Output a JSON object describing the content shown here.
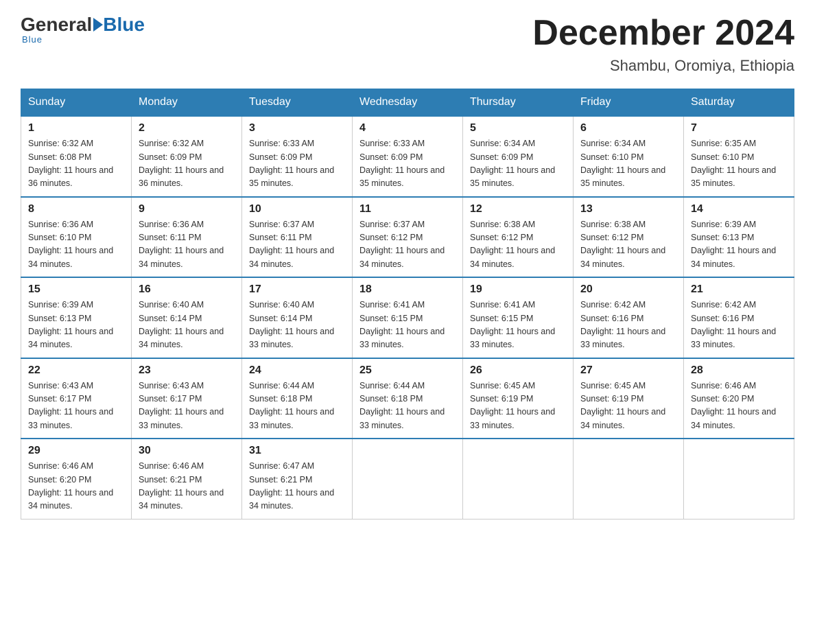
{
  "logo": {
    "general": "General",
    "blue": "Blue",
    "underline": "Blue"
  },
  "header": {
    "month": "December 2024",
    "location": "Shambu, Oromiya, Ethiopia"
  },
  "days_of_week": [
    "Sunday",
    "Monday",
    "Tuesday",
    "Wednesday",
    "Thursday",
    "Friday",
    "Saturday"
  ],
  "weeks": [
    [
      {
        "day": "1",
        "sunrise": "6:32 AM",
        "sunset": "6:08 PM",
        "daylight": "11 hours and 36 minutes."
      },
      {
        "day": "2",
        "sunrise": "6:32 AM",
        "sunset": "6:09 PM",
        "daylight": "11 hours and 36 minutes."
      },
      {
        "day": "3",
        "sunrise": "6:33 AM",
        "sunset": "6:09 PM",
        "daylight": "11 hours and 35 minutes."
      },
      {
        "day": "4",
        "sunrise": "6:33 AM",
        "sunset": "6:09 PM",
        "daylight": "11 hours and 35 minutes."
      },
      {
        "day": "5",
        "sunrise": "6:34 AM",
        "sunset": "6:09 PM",
        "daylight": "11 hours and 35 minutes."
      },
      {
        "day": "6",
        "sunrise": "6:34 AM",
        "sunset": "6:10 PM",
        "daylight": "11 hours and 35 minutes."
      },
      {
        "day": "7",
        "sunrise": "6:35 AM",
        "sunset": "6:10 PM",
        "daylight": "11 hours and 35 minutes."
      }
    ],
    [
      {
        "day": "8",
        "sunrise": "6:36 AM",
        "sunset": "6:10 PM",
        "daylight": "11 hours and 34 minutes."
      },
      {
        "day": "9",
        "sunrise": "6:36 AM",
        "sunset": "6:11 PM",
        "daylight": "11 hours and 34 minutes."
      },
      {
        "day": "10",
        "sunrise": "6:37 AM",
        "sunset": "6:11 PM",
        "daylight": "11 hours and 34 minutes."
      },
      {
        "day": "11",
        "sunrise": "6:37 AM",
        "sunset": "6:12 PM",
        "daylight": "11 hours and 34 minutes."
      },
      {
        "day": "12",
        "sunrise": "6:38 AM",
        "sunset": "6:12 PM",
        "daylight": "11 hours and 34 minutes."
      },
      {
        "day": "13",
        "sunrise": "6:38 AM",
        "sunset": "6:12 PM",
        "daylight": "11 hours and 34 minutes."
      },
      {
        "day": "14",
        "sunrise": "6:39 AM",
        "sunset": "6:13 PM",
        "daylight": "11 hours and 34 minutes."
      }
    ],
    [
      {
        "day": "15",
        "sunrise": "6:39 AM",
        "sunset": "6:13 PM",
        "daylight": "11 hours and 34 minutes."
      },
      {
        "day": "16",
        "sunrise": "6:40 AM",
        "sunset": "6:14 PM",
        "daylight": "11 hours and 34 minutes."
      },
      {
        "day": "17",
        "sunrise": "6:40 AM",
        "sunset": "6:14 PM",
        "daylight": "11 hours and 33 minutes."
      },
      {
        "day": "18",
        "sunrise": "6:41 AM",
        "sunset": "6:15 PM",
        "daylight": "11 hours and 33 minutes."
      },
      {
        "day": "19",
        "sunrise": "6:41 AM",
        "sunset": "6:15 PM",
        "daylight": "11 hours and 33 minutes."
      },
      {
        "day": "20",
        "sunrise": "6:42 AM",
        "sunset": "6:16 PM",
        "daylight": "11 hours and 33 minutes."
      },
      {
        "day": "21",
        "sunrise": "6:42 AM",
        "sunset": "6:16 PM",
        "daylight": "11 hours and 33 minutes."
      }
    ],
    [
      {
        "day": "22",
        "sunrise": "6:43 AM",
        "sunset": "6:17 PM",
        "daylight": "11 hours and 33 minutes."
      },
      {
        "day": "23",
        "sunrise": "6:43 AM",
        "sunset": "6:17 PM",
        "daylight": "11 hours and 33 minutes."
      },
      {
        "day": "24",
        "sunrise": "6:44 AM",
        "sunset": "6:18 PM",
        "daylight": "11 hours and 33 minutes."
      },
      {
        "day": "25",
        "sunrise": "6:44 AM",
        "sunset": "6:18 PM",
        "daylight": "11 hours and 33 minutes."
      },
      {
        "day": "26",
        "sunrise": "6:45 AM",
        "sunset": "6:19 PM",
        "daylight": "11 hours and 33 minutes."
      },
      {
        "day": "27",
        "sunrise": "6:45 AM",
        "sunset": "6:19 PM",
        "daylight": "11 hours and 34 minutes."
      },
      {
        "day": "28",
        "sunrise": "6:46 AM",
        "sunset": "6:20 PM",
        "daylight": "11 hours and 34 minutes."
      }
    ],
    [
      {
        "day": "29",
        "sunrise": "6:46 AM",
        "sunset": "6:20 PM",
        "daylight": "11 hours and 34 minutes."
      },
      {
        "day": "30",
        "sunrise": "6:46 AM",
        "sunset": "6:21 PM",
        "daylight": "11 hours and 34 minutes."
      },
      {
        "day": "31",
        "sunrise": "6:47 AM",
        "sunset": "6:21 PM",
        "daylight": "11 hours and 34 minutes."
      },
      null,
      null,
      null,
      null
    ]
  ]
}
